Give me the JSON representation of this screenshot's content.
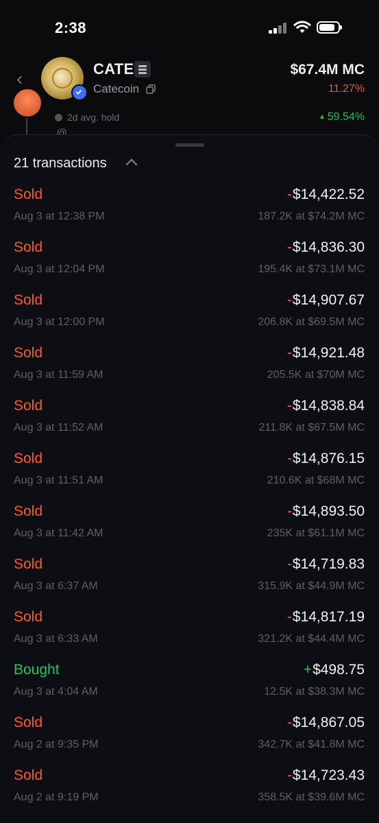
{
  "status_bar": {
    "time": "2:38"
  },
  "token": {
    "ticker": "CATE",
    "name": "Catecoin",
    "market_cap": "$67.4M MC",
    "change": "11.27%",
    "change_color": "#e8533a"
  },
  "peek_row": {
    "hold": "2d avg. hold",
    "percent": "59.54%",
    "snippet": "@"
  },
  "sheet": {
    "transactions_label": "21 transactions"
  },
  "colors": {
    "sold": "#ff5a2a",
    "bought": "#22c55e",
    "background": "#0b0b0e"
  },
  "transactions": [
    {
      "type": "Sold",
      "kind": "sold",
      "sign": "-",
      "amount": "$14,422.52",
      "date": "Aug 3 at 12:38 PM",
      "detail": "187.2K at $74.2M MC"
    },
    {
      "type": "Sold",
      "kind": "sold",
      "sign": "-",
      "amount": "$14,836.30",
      "date": "Aug 3 at 12:04 PM",
      "detail": "195.4K at $73.1M MC"
    },
    {
      "type": "Sold",
      "kind": "sold",
      "sign": "-",
      "amount": "$14,907.67",
      "date": "Aug 3 at 12:00 PM",
      "detail": "206.8K at $69.5M MC"
    },
    {
      "type": "Sold",
      "kind": "sold",
      "sign": "-",
      "amount": "$14,921.48",
      "date": "Aug 3 at 11:59 AM",
      "detail": "205.5K at $70M MC"
    },
    {
      "type": "Sold",
      "kind": "sold",
      "sign": "-",
      "amount": "$14,838.84",
      "date": "Aug 3 at 11:52 AM",
      "detail": "211.8K at $67.5M MC"
    },
    {
      "type": "Sold",
      "kind": "sold",
      "sign": "-",
      "amount": "$14,876.15",
      "date": "Aug 3 at 11:51 AM",
      "detail": "210.6K at $68M MC"
    },
    {
      "type": "Sold",
      "kind": "sold",
      "sign": "-",
      "amount": "$14,893.50",
      "date": "Aug 3 at 11:42 AM",
      "detail": "235K at $61.1M MC"
    },
    {
      "type": "Sold",
      "kind": "sold",
      "sign": "-",
      "amount": "$14,719.83",
      "date": "Aug 3 at 6:37 AM",
      "detail": "315.9K at $44.9M MC"
    },
    {
      "type": "Sold",
      "kind": "sold",
      "sign": "-",
      "amount": "$14,817.19",
      "date": "Aug 3 at 6:33 AM",
      "detail": "321.2K at $44.4M MC"
    },
    {
      "type": "Bought",
      "kind": "bought",
      "sign": "+",
      "amount": "$498.75",
      "date": "Aug 3 at 4:04 AM",
      "detail": "12.5K at $38.3M MC"
    },
    {
      "type": "Sold",
      "kind": "sold",
      "sign": "-",
      "amount": "$14,867.05",
      "date": "Aug 2 at 9:35 PM",
      "detail": "342.7K at $41.8M MC"
    },
    {
      "type": "Sold",
      "kind": "sold",
      "sign": "-",
      "amount": "$14,723.43",
      "date": "Aug 2 at 9:19 PM",
      "detail": "358.5K at $39.6M MC"
    }
  ]
}
